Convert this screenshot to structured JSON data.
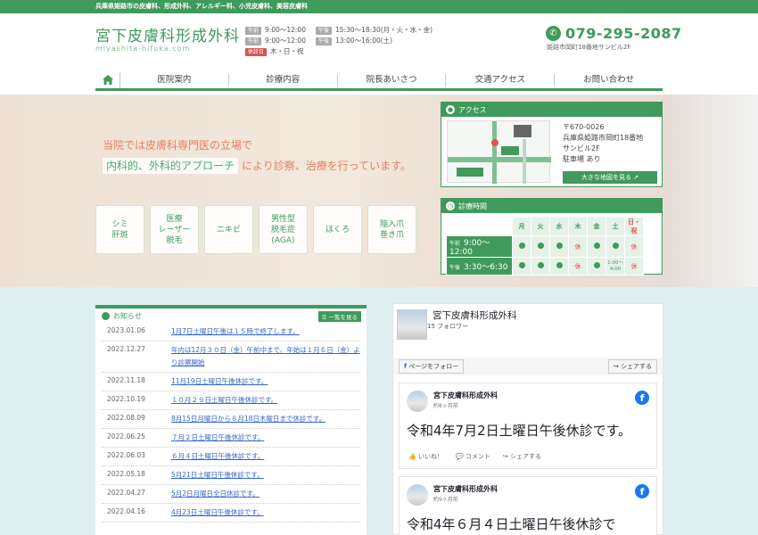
{
  "topbar": {
    "text": "兵庫県姫路市の皮膚科、形成外科、アレルギー科、小児皮膚科、美容皮膚科"
  },
  "header": {
    "title": "宮下皮膚科形成外科",
    "subtitle": "miyashita-hifuka.com",
    "hours_col1": [
      {
        "tag": "午前",
        "time": "9:00〜12:00"
      },
      {
        "tag": "午前",
        "time": "9:00〜12:00"
      },
      {
        "tag": "休診日",
        "time": "木・日・祝"
      }
    ],
    "hours_col2": [
      {
        "tag": "午後",
        "time": "15:30〜18:30(月・火・水・金)"
      },
      {
        "tag": "午後",
        "time": "13:00〜16:00(土)"
      }
    ],
    "phone": "079-295-2087",
    "address": "姫路市岡町18番地サンビル2F"
  },
  "nav": {
    "items": [
      "医院案内",
      "診療内容",
      "院長あいさつ",
      "交通アクセス",
      "お問い合わせ"
    ]
  },
  "hero": {
    "line1": "当院では皮膚科専門医の立場で",
    "line2_highlight": "内科的、外科的アプローチ",
    "line2_rest": "により診察、治療を行っています。",
    "services": [
      "シミ\n肝斑",
      "医療\nレーザー\n脱毛",
      "ニキビ",
      "男性型\n脱毛症\n(AGA)",
      "ほくろ",
      "陥入爪\n巻き爪"
    ]
  },
  "access": {
    "title": "アクセス",
    "postal": "〒670-0026",
    "addr1": "兵庫県姫路市岡町18番地",
    "addr2": "サンビル2F",
    "parking": "駐車場 あり",
    "map_button": "大きな地図を見る ↗"
  },
  "schedule": {
    "title": "診療時間",
    "days": [
      "月",
      "火",
      "水",
      "木",
      "金",
      "土",
      "日・祝"
    ],
    "rows": [
      {
        "label_small": "午前",
        "label": "9:00〜12:00",
        "cells": [
          "●",
          "●",
          "●",
          "休",
          "●",
          "●",
          "休"
        ]
      },
      {
        "label_small": "午後",
        "label": "3:30〜6:30",
        "cells": [
          "●",
          "●",
          "●",
          "休",
          "●",
          "1:00〜\n4:00",
          "休"
        ]
      }
    ]
  },
  "news": {
    "title": "お知らせ",
    "list_button": "☰ 一覧を見る",
    "items": [
      {
        "date": "2023.01.06",
        "text": "1月7日土曜日午後は１５時で終了します。"
      },
      {
        "date": "2022.12.27",
        "text": "年内は12月３０日（金）午前中まで、年始は１月６日（金）より診察開始"
      },
      {
        "date": "2022.11.18",
        "text": "11月19日土曜日午後休診です。"
      },
      {
        "date": "2022.10.19",
        "text": "１０月２９日土曜日午後休診です。"
      },
      {
        "date": "2022.08.09",
        "text": "8月15日月曜日から８月18日木曜日まで休診です。"
      },
      {
        "date": "2022.06.25",
        "text": "７月２日土曜日午後休診です。"
      },
      {
        "date": "2022.06.03",
        "text": "６月４日土曜日午後休診です。"
      },
      {
        "date": "2022.05.18",
        "text": "5月21日土曜日午後休診です。"
      },
      {
        "date": "2022.04.27",
        "text": "5月2日月曜日全日休診です。"
      },
      {
        "date": "2022.04.16",
        "text": "4月23日土曜日午後休診です。"
      }
    ]
  },
  "facebook": {
    "page_name": "宮下皮膚科形成外科",
    "followers": "15 フォロワー",
    "follow_button": "ページをフォロー",
    "share_button": "シェアする",
    "posts": [
      {
        "name": "宮下皮膚科形成外科",
        "time": "約8ヶ月前",
        "text": "令和4年7月2日土曜日午後休診です。",
        "like": "いいね！",
        "comment": "コメント",
        "share": "シェアする"
      },
      {
        "name": "宮下皮膚科形成外科",
        "time": "約9ヶ月前",
        "text": "令和4年６月４日土曜日午後休診で"
      }
    ]
  },
  "colors": {
    "brand_green": "#3f9a5b",
    "accent_orange": "#e87f5f",
    "lower_bg": "#dcefee"
  }
}
